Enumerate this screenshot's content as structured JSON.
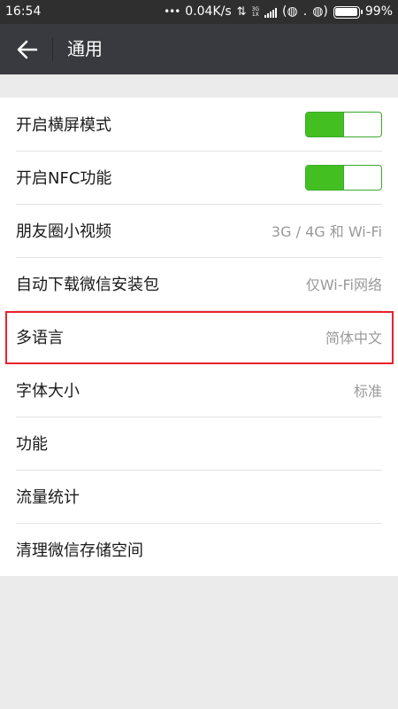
{
  "status_bar": {
    "time": "16:54",
    "dots": "•••",
    "net_speed": "0.04K/s",
    "network_small_top": "3G",
    "network_small_bottom": "1X",
    "sim1": "(◍",
    "sim_sep": ".",
    "sim2": "◍)",
    "battery": "99%"
  },
  "app_bar": {
    "title": "通用",
    "back_icon": "arrow-left-icon"
  },
  "settings": {
    "landscape": {
      "label": "开启横屏模式",
      "enabled": true
    },
    "nfc": {
      "label": "开启NFC功能",
      "enabled": true
    },
    "moments_video": {
      "label": "朋友圈小视频",
      "value": "3G / 4G 和 Wi-Fi"
    },
    "auto_download": {
      "label": "自动下载微信安装包",
      "value": "仅Wi-Fi网络"
    },
    "language": {
      "label": "多语言",
      "value": "简体中文"
    },
    "font_size": {
      "label": "字体大小",
      "value": "标准"
    },
    "features": {
      "label": "功能"
    },
    "data_usage": {
      "label": "流量统计"
    },
    "storage": {
      "label": "清理微信存储空间"
    }
  },
  "colors": {
    "toggle_on": "#44bf22",
    "highlight": "#e8212b",
    "app_bar": "#393a3f"
  }
}
